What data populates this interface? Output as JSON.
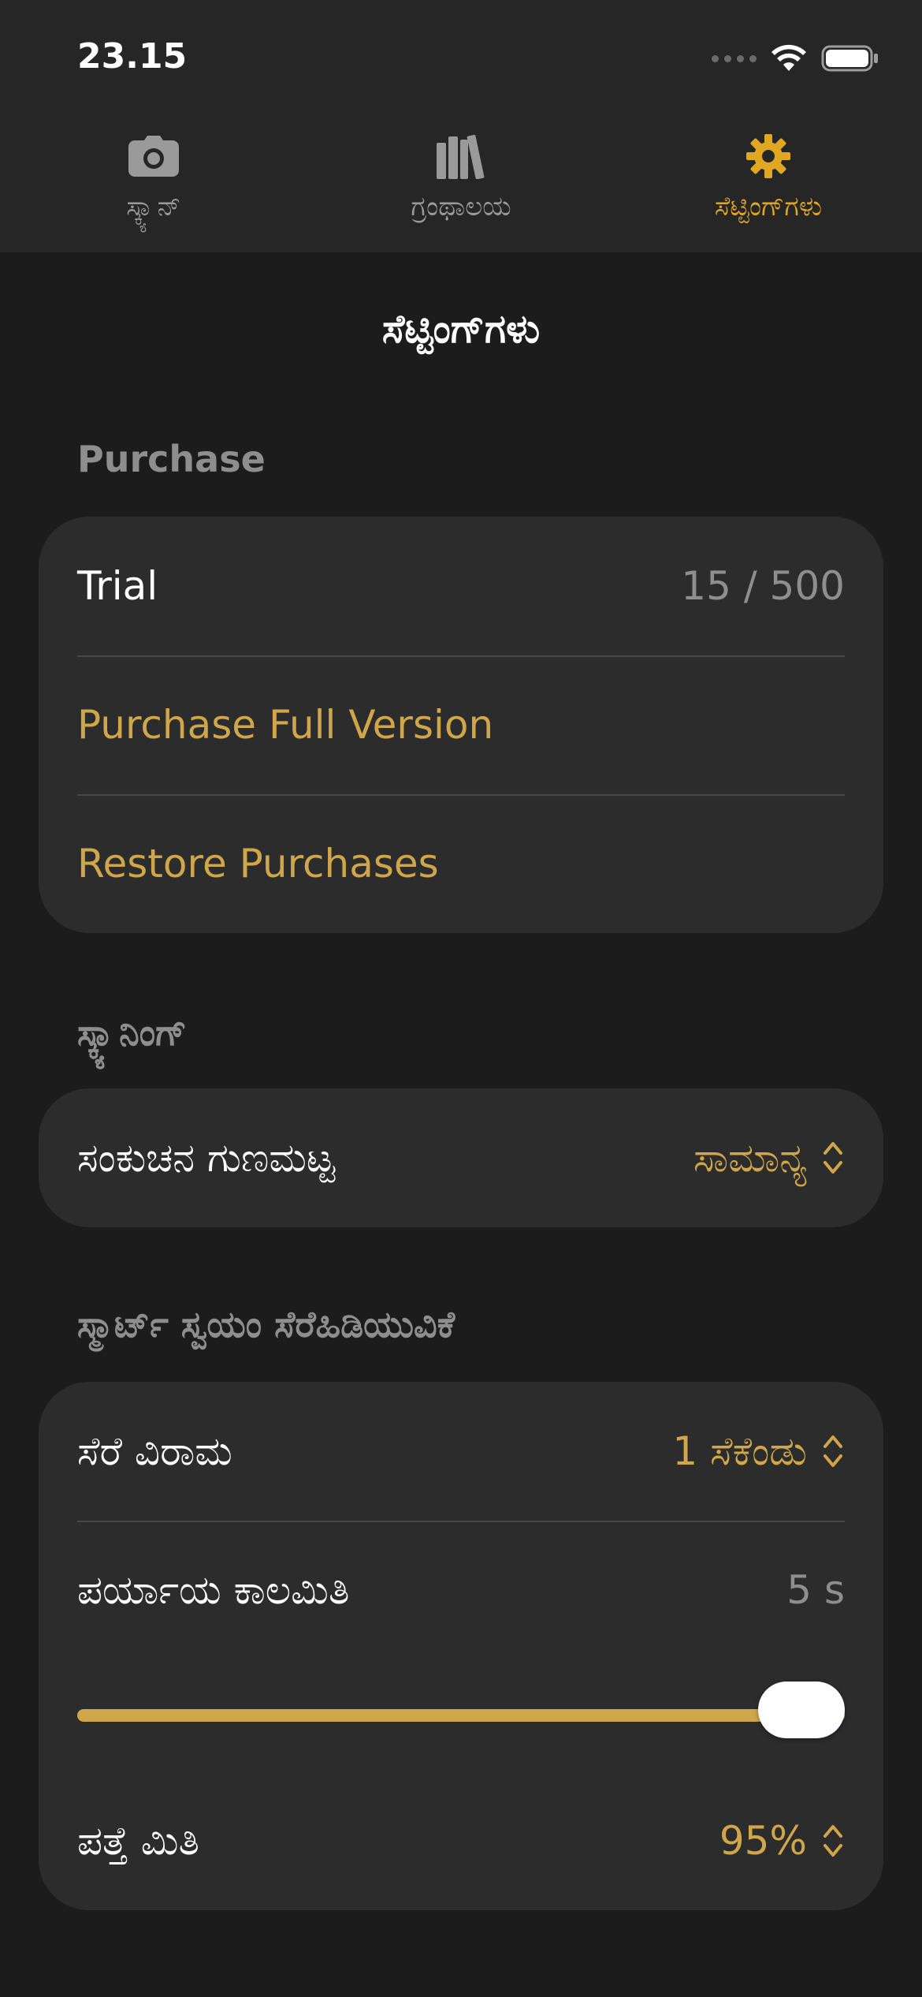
{
  "status_bar": {
    "time": "23.15"
  },
  "tabs": [
    {
      "label": "ಸ್ಕ್ಯಾನ್",
      "icon": "camera-icon",
      "active": false
    },
    {
      "label": "ಗ್ರಂಥಾಲಯ",
      "icon": "books-icon",
      "active": false
    },
    {
      "label": "ಸೆಟ್ಟಿಂಗ್‌ಗಳು",
      "icon": "gear-icon",
      "active": true
    }
  ],
  "page": {
    "title": "ಸೆಟ್ಟಿಂಗ್‌ಗಳು"
  },
  "purchase": {
    "header": "Purchase",
    "trial_label": "Trial",
    "trial_value": "15 / 500",
    "purchase_full_label": "Purchase Full Version",
    "restore_label": "Restore Purchases"
  },
  "scanning": {
    "header": "ಸ್ಕ್ಯಾನಿಂಗ್",
    "compression_label": "ಸಂಕುಚನ ಗುಣಮಟ್ಟ",
    "compression_value": "ಸಾಮಾನ್ಯ"
  },
  "smart_crop": {
    "header": "ಸ್ಮಾರ್ಟ್ ಸ್ವಯಂ ಸೆರೆಹಿಡಿಯುವಿಕೆ",
    "capture_pause_label": "ಸೆರೆ ವಿರಾಮ",
    "capture_pause_value": "1 ಸೆಕೆಂಡು",
    "timeout_label": "ಪರ್ಯಾಯ ಕಾಲಮಿತಿ",
    "timeout_value": "5 s",
    "timeout_slider_fraction": 1.0,
    "detection_label": "ಪತ್ತೆ ಮಿತಿ",
    "detection_value": "95%"
  },
  "colors": {
    "accent": "#e0a722",
    "accent_text": "#cfa64a",
    "background": "#1c1c1c",
    "card": "#2c2c2c",
    "tabbar": "#262626"
  }
}
